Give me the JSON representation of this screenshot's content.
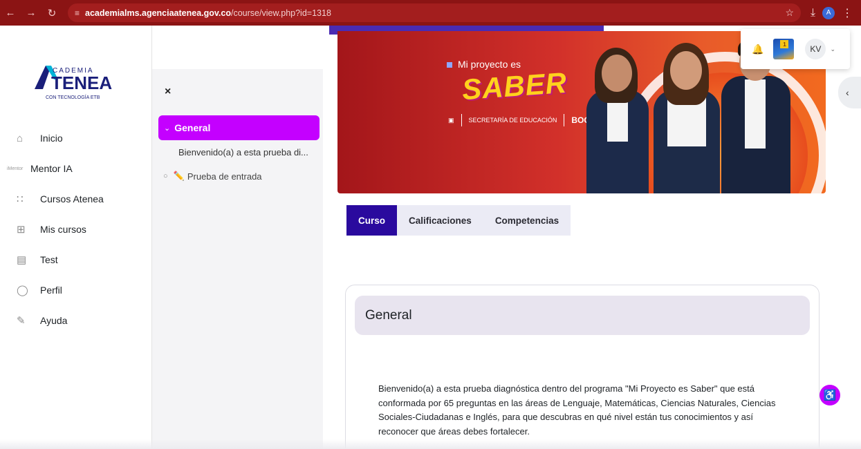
{
  "browser": {
    "url_domain": "academialms.agenciaatenea.gov.co",
    "url_path": "/course/view.php?id=1318",
    "profile_initial": "A"
  },
  "logo": {
    "line1": "CADEMIA",
    "line2": "TENEA",
    "tagline": "CON TECNOLOGÍA ETB"
  },
  "nav": {
    "items": [
      {
        "label": "Inicio",
        "icon": "home-icon"
      },
      {
        "label": "Mentor IA",
        "icon": "mentor-icon",
        "icon_text": "iMentor"
      },
      {
        "label": "Cursos Atenea",
        "icon": "grid-icon"
      },
      {
        "label": "Mis cursos",
        "icon": "plus-box-icon"
      },
      {
        "label": "Test",
        "icon": "chat-icon"
      },
      {
        "label": "Perfil",
        "icon": "user-icon"
      },
      {
        "label": "Ayuda",
        "icon": "pencil-icon"
      }
    ]
  },
  "course_index": {
    "close": "×",
    "section": "General",
    "link": "Bienvenido(a) a esta prueba di...",
    "activity": "Prueba de entrada"
  },
  "banner": {
    "tag": "Mi proyecto es",
    "headline": "SABER",
    "logo_edu": "SECRETARÍA DE EDUCACIÓN",
    "logo_city": "BOGOTÁ"
  },
  "tabs": [
    {
      "label": "Curso",
      "active": true
    },
    {
      "label": "Calificaciones",
      "active": false
    },
    {
      "label": "Competencias",
      "active": false
    }
  ],
  "section": {
    "title": "General",
    "body": "Bienvenido(a) a esta prueba diagnóstica dentro del programa \"Mi Proyecto es Saber\" que está conformada por 65 preguntas en las áreas de Lenguaje, Matemáticas, Ciencias Naturales, Ciencias Sociales-Ciudadanas e Inglés, para que descubras en qué nivel están tus conocimientos y así reconocer que áreas debes fortalecer."
  },
  "user": {
    "initials": "KV",
    "app_badge": "1"
  },
  "colors": {
    "accent_purple": "#c400ff",
    "tab_active": "#2a0a9e",
    "browser_bar": "#8b1414"
  }
}
